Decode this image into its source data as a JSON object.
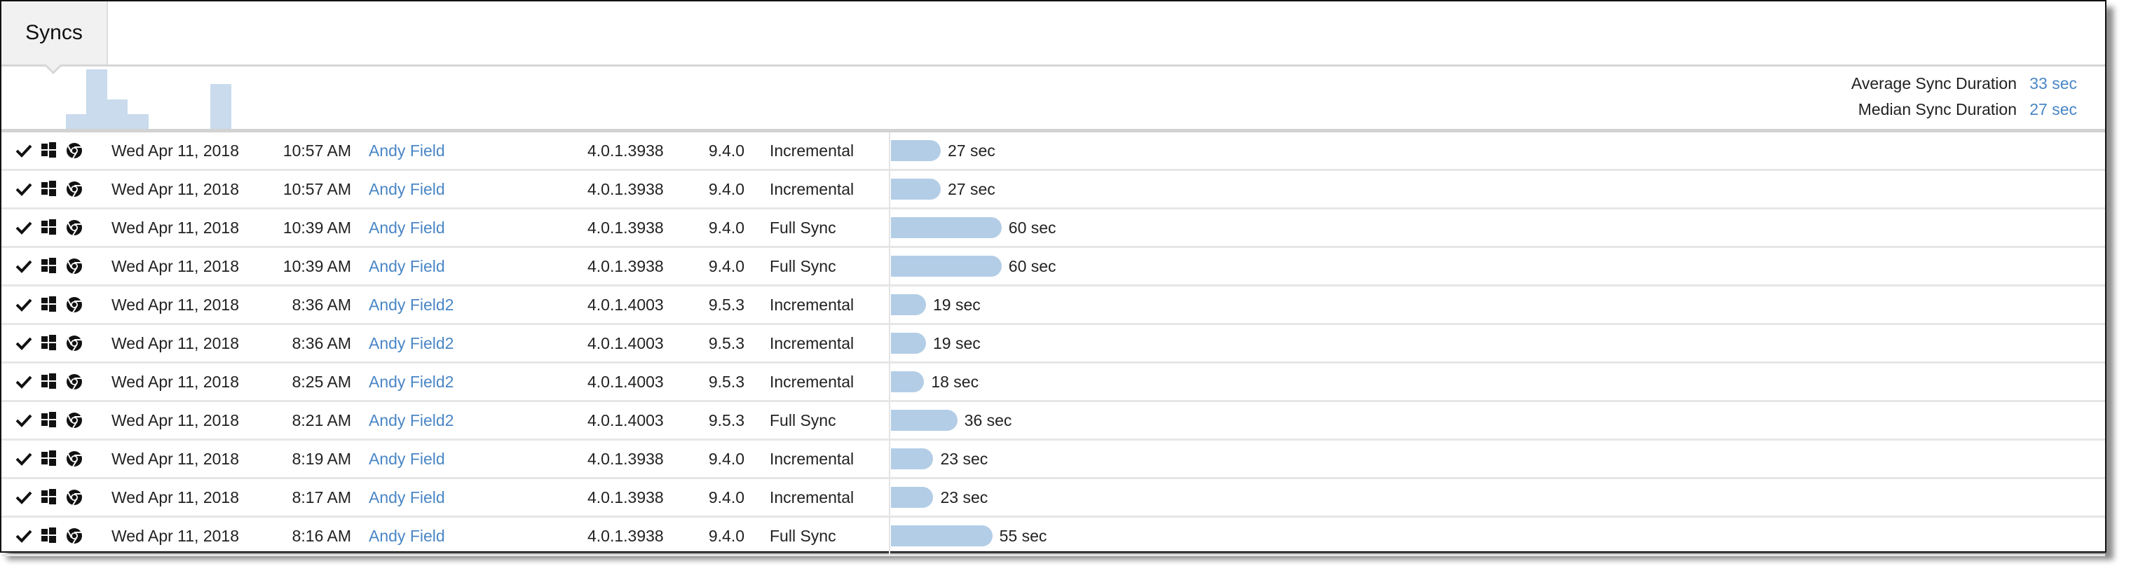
{
  "tab": {
    "label": "Syncs"
  },
  "summary": {
    "average_label": "Average Sync Duration",
    "average_value": "33 sec",
    "median_label": "Median Sync Duration",
    "median_value": "27 sec"
  },
  "histogram": {
    "bin_counts": [
      0,
      0,
      0,
      1,
      4,
      2,
      1,
      0,
      0,
      0,
      3
    ],
    "color": "#c9dbec"
  },
  "colors": {
    "link": "#4a86c5",
    "bar": "#b3cde6"
  },
  "rows": [
    {
      "status_icon": "check-icon",
      "os_icon": "windows-icon",
      "browser_icon": "chrome-icon",
      "date": "Wed Apr 11, 2018",
      "time": "10:57 AM",
      "user": "Andy Field",
      "client_version": "4.0.1.3938",
      "server_version": "9.4.0",
      "type": "Incremental",
      "duration_sec": 27,
      "duration": "27 sec"
    },
    {
      "status_icon": "check-icon",
      "os_icon": "windows-icon",
      "browser_icon": "chrome-icon",
      "date": "Wed Apr 11, 2018",
      "time": "10:57 AM",
      "user": "Andy Field",
      "client_version": "4.0.1.3938",
      "server_version": "9.4.0",
      "type": "Incremental",
      "duration_sec": 27,
      "duration": "27 sec"
    },
    {
      "status_icon": "check-icon",
      "os_icon": "windows-icon",
      "browser_icon": "chrome-icon",
      "date": "Wed Apr 11, 2018",
      "time": "10:39 AM",
      "user": "Andy Field",
      "client_version": "4.0.1.3938",
      "server_version": "9.4.0",
      "type": "Full Sync",
      "duration_sec": 60,
      "duration": "60 sec"
    },
    {
      "status_icon": "check-icon",
      "os_icon": "windows-icon",
      "browser_icon": "chrome-icon",
      "date": "Wed Apr 11, 2018",
      "time": "10:39 AM",
      "user": "Andy Field",
      "client_version": "4.0.1.3938",
      "server_version": "9.4.0",
      "type": "Full Sync",
      "duration_sec": 60,
      "duration": "60 sec"
    },
    {
      "status_icon": "check-icon",
      "os_icon": "windows-icon",
      "browser_icon": "chrome-icon",
      "date": "Wed Apr 11, 2018",
      "time": "8:36 AM",
      "user": "Andy Field2",
      "client_version": "4.0.1.4003",
      "server_version": "9.5.3",
      "type": "Incremental",
      "duration_sec": 19,
      "duration": "19 sec"
    },
    {
      "status_icon": "check-icon",
      "os_icon": "windows-icon",
      "browser_icon": "chrome-icon",
      "date": "Wed Apr 11, 2018",
      "time": "8:36 AM",
      "user": "Andy Field2",
      "client_version": "4.0.1.4003",
      "server_version": "9.5.3",
      "type": "Incremental",
      "duration_sec": 19,
      "duration": "19 sec"
    },
    {
      "status_icon": "check-icon",
      "os_icon": "windows-icon",
      "browser_icon": "chrome-icon",
      "date": "Wed Apr 11, 2018",
      "time": "8:25 AM",
      "user": "Andy Field2",
      "client_version": "4.0.1.4003",
      "server_version": "9.5.3",
      "type": "Incremental",
      "duration_sec": 18,
      "duration": "18 sec"
    },
    {
      "status_icon": "check-icon",
      "os_icon": "windows-icon",
      "browser_icon": "chrome-icon",
      "date": "Wed Apr 11, 2018",
      "time": "8:21 AM",
      "user": "Andy Field2",
      "client_version": "4.0.1.4003",
      "server_version": "9.5.3",
      "type": "Full Sync",
      "duration_sec": 36,
      "duration": "36 sec"
    },
    {
      "status_icon": "check-icon",
      "os_icon": "windows-icon",
      "browser_icon": "chrome-icon",
      "date": "Wed Apr 11, 2018",
      "time": "8:19 AM",
      "user": "Andy Field",
      "client_version": "4.0.1.3938",
      "server_version": "9.4.0",
      "type": "Incremental",
      "duration_sec": 23,
      "duration": "23 sec"
    },
    {
      "status_icon": "check-icon",
      "os_icon": "windows-icon",
      "browser_icon": "chrome-icon",
      "date": "Wed Apr 11, 2018",
      "time": "8:17 AM",
      "user": "Andy Field",
      "client_version": "4.0.1.3938",
      "server_version": "9.4.0",
      "type": "Incremental",
      "duration_sec": 23,
      "duration": "23 sec"
    },
    {
      "status_icon": "check-icon",
      "os_icon": "windows-icon",
      "browser_icon": "chrome-icon",
      "date": "Wed Apr 11, 2018",
      "time": "8:16 AM",
      "user": "Andy Field",
      "client_version": "4.0.1.3938",
      "server_version": "9.4.0",
      "type": "Full Sync",
      "duration_sec": 55,
      "duration": "55 sec"
    }
  ]
}
